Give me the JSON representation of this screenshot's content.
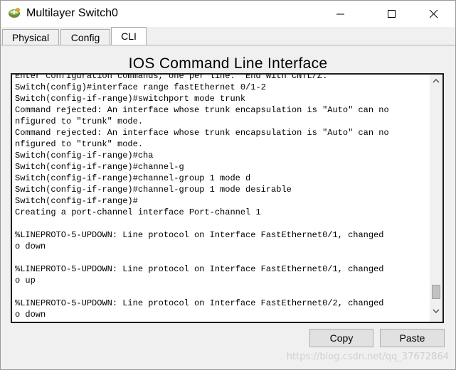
{
  "window": {
    "title": "Multilayer Switch0",
    "icon": "multilayer-switch-icon"
  },
  "controls": {
    "minimize_icon": "minimize-icon",
    "maximize_icon": "maximize-icon",
    "close_icon": "close-icon"
  },
  "tabs": [
    {
      "label": "Physical",
      "active": false
    },
    {
      "label": "Config",
      "active": false
    },
    {
      "label": "CLI",
      "active": true
    }
  ],
  "cli": {
    "heading": "IOS Command Line Interface",
    "lines": [
      "Enter configuration commands, one per line.  End with CNTL/Z.",
      "Switch(config)#interface range fastEthernet 0/1-2",
      "Switch(config-if-range)#switchport mode trunk",
      "Command rejected: An interface whose trunk encapsulation is \"Auto\" can no",
      "nfigured to \"trunk\" mode.",
      "Command rejected: An interface whose trunk encapsulation is \"Auto\" can no",
      "nfigured to \"trunk\" mode.",
      "Switch(config-if-range)#cha",
      "Switch(config-if-range)#channel-g",
      "Switch(config-if-range)#channel-group 1 mode d",
      "Switch(config-if-range)#channel-group 1 mode desirable",
      "Switch(config-if-range)#",
      "Creating a port-channel interface Port-channel 1",
      "",
      "%LINEPROTO-5-UPDOWN: Line protocol on Interface FastEthernet0/1, changed",
      "o down",
      "",
      "%LINEPROTO-5-UPDOWN: Line protocol on Interface FastEthernet0/1, changed",
      "o up",
      "",
      "%LINEPROTO-5-UPDOWN: Line protocol on Interface FastEthernet0/2, changed",
      "o down"
    ]
  },
  "buttons": {
    "copy": "Copy",
    "paste": "Paste"
  },
  "watermark": "https://blog.csdn.net/qq_37672864",
  "colors": {
    "console_border": "#1e1e1e",
    "button_face": "#e1e1e1",
    "panel_bg": "#f0f0f0"
  }
}
